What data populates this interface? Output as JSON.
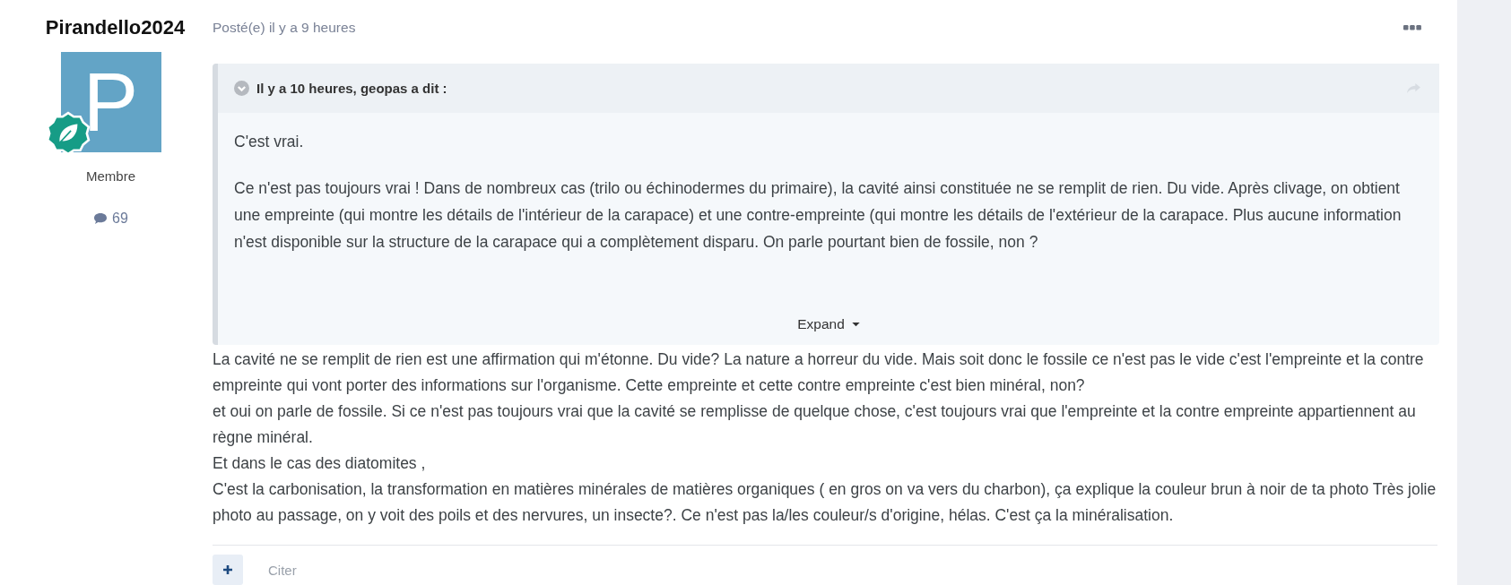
{
  "author": {
    "name": "Pirandello2024",
    "avatar_letter": "P",
    "rank": "Membre",
    "post_count": "69"
  },
  "post": {
    "meta": "Posté(e) il y a 9 heures",
    "quote": {
      "header": "Il y a 10 heures, geopas a dit :",
      "paragraphs": [
        "C'est vrai.",
        "Ce n'est pas toujours vrai ! Dans de nombreux cas (trilo ou échinodermes du primaire), la cavité ainsi constituée ne se remplit de rien. Du vide. Après clivage, on obtient une empreinte (qui montre les détails de l'intérieur de la carapace) et une contre-empreinte (qui montre les détails de l'extérieur de la carapace. Plus aucune information n'est disponible sur la structure de la carapace qui a complètement disparu. On parle pourtant bien de fossile, non ?"
      ],
      "expand": "Expand"
    },
    "paragraphs": [
      "La cavité ne se remplit de rien est une affirmation qui m'étonne. Du vide? La nature a horreur du vide. Mais soit donc le fossile ce n'est pas le vide c'est l'empreinte et la contre empreinte qui vont porter des informations sur l'organisme. Cette empreinte et cette contre empreinte c'est bien minéral, non?",
      "et oui on parle de fossile. Si ce n'est pas toujours vrai que la cavité se remplisse de quelque chose, c'est toujours vrai que l'empreinte et la contre empreinte appartiennent au règne minéral.",
      "Et dans le cas des diatomites ,",
      "C'est la carbonisation, la transformation en matières minérales de matières organiques ( en gros on va vers du charbon), ça explique la couleur brun à noir de ta photo Très jolie photo au passage, on y voit des poils et des nervures, un insecte?. Ce n'est pas la/les couleur/s d'origine, hélas. C'est ça la minéralisation."
    ],
    "quote_action": "Citer"
  }
}
